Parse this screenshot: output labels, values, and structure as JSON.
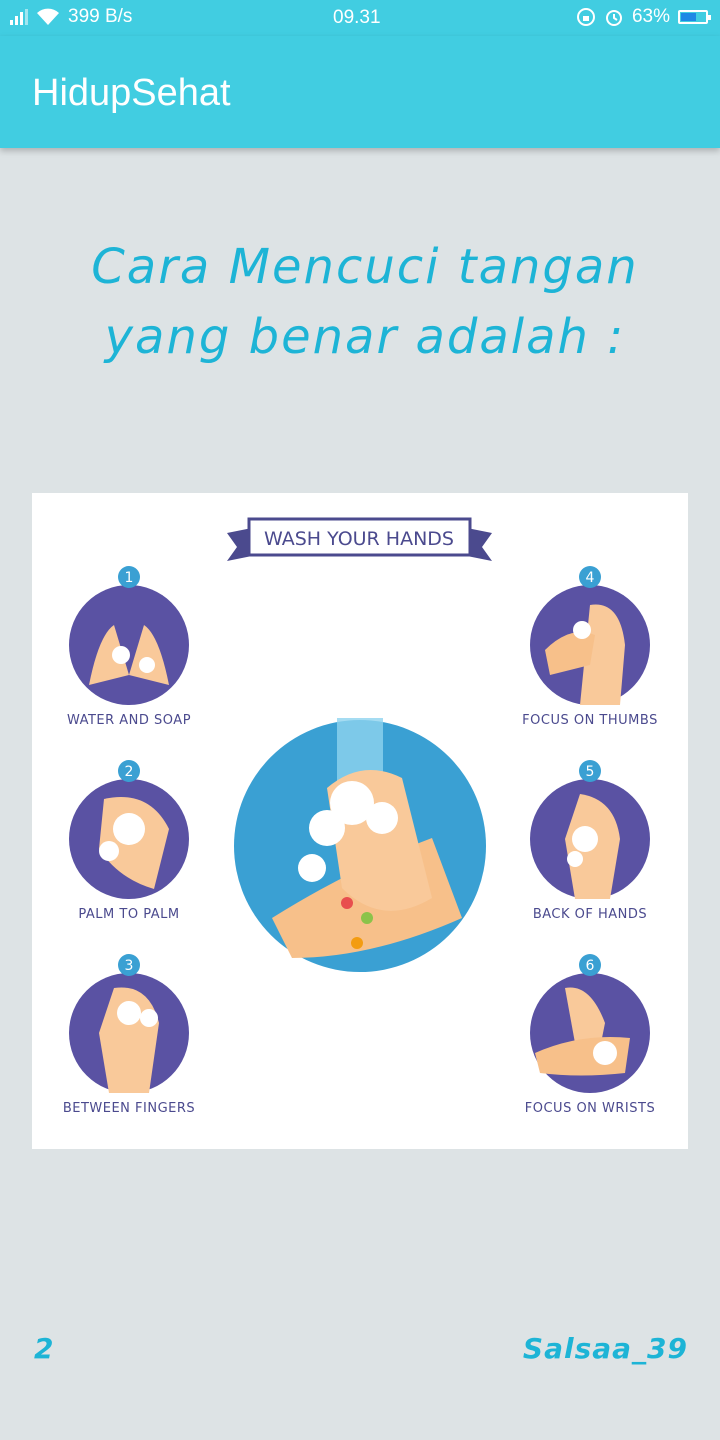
{
  "status_bar": {
    "network_speed": "399 B/s",
    "time": "09.31",
    "battery_percent": "63%",
    "battery_level": 0.63
  },
  "app_bar": {
    "title": "HidupSehat"
  },
  "heading": {
    "line1": "Cara Mencuci tangan",
    "line2": "yang benar adalah :"
  },
  "illustration": {
    "banner": "WASH YOUR HANDS",
    "steps": [
      {
        "number": "1",
        "caption": "WATER AND SOAP"
      },
      {
        "number": "2",
        "caption": "PALM TO PALM"
      },
      {
        "number": "3",
        "caption": "BETWEEN FINGERS"
      },
      {
        "number": "4",
        "caption": "FOCUS ON THUMBS"
      },
      {
        "number": "5",
        "caption": "BACK OF HANDS"
      },
      {
        "number": "6",
        "caption": "FOCUS ON WRISTS"
      }
    ]
  },
  "footer": {
    "page_number": "2",
    "author": "Salsaa_39"
  },
  "colors": {
    "accent": "#41cde1",
    "heading": "#1db4d6",
    "background": "#dde3e5",
    "step_circle": "#5a52a3",
    "step_badge": "#3aa0d3"
  }
}
